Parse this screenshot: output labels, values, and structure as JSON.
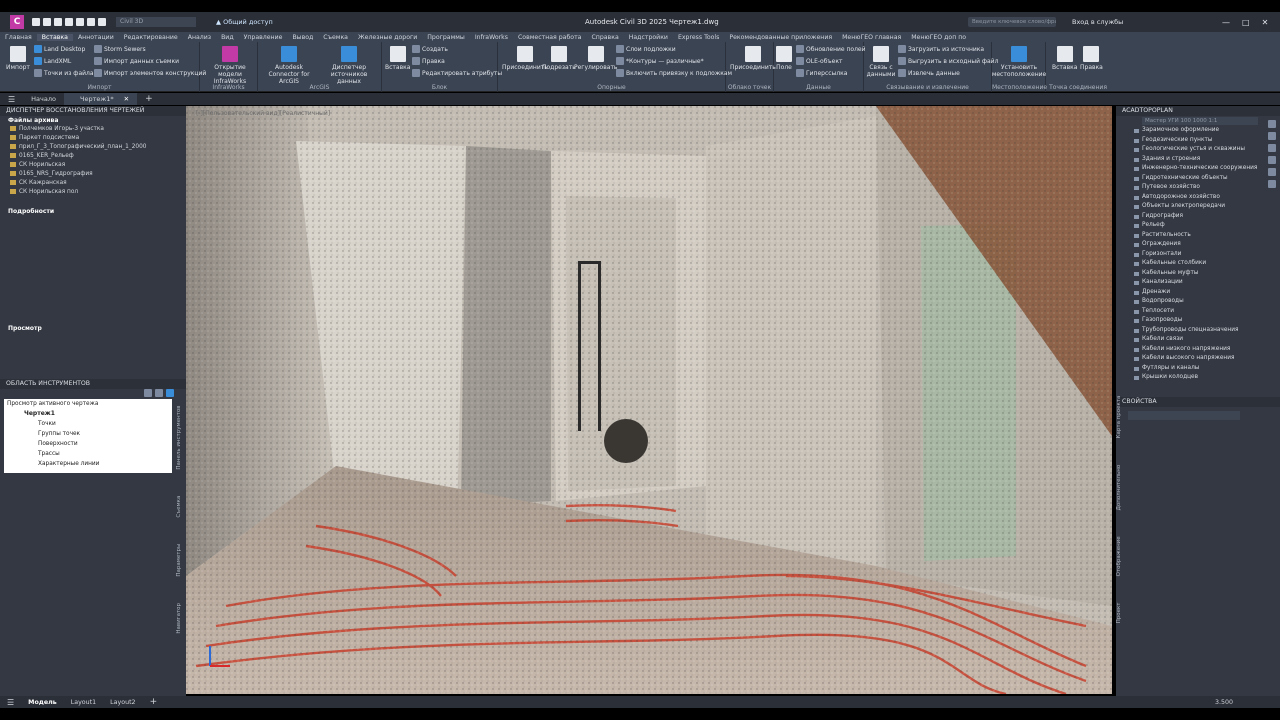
{
  "window": {
    "title": "Autodesk Civil 3D 2025   Чертеж1.dwg",
    "search_placeholder": "Введите ключевое слово/фразу",
    "signin": "Вход в службы",
    "share": "Общий доступ",
    "workspace": "Civil 3D"
  },
  "ribbon_tabs": [
    "Главная",
    "Вставка",
    "Аннотации",
    "Редактирование",
    "Анализ",
    "Вид",
    "Управление",
    "Вывод",
    "Съемка",
    "Железные дороги",
    "Программы",
    "InfraWorks",
    "Совместная работа",
    "Справка",
    "Надстройки",
    "Express Tools",
    "Рекомендованные приложения",
    "МенюГЕО главная",
    "МенюГЕО доп по"
  ],
  "ribbon_active": "Вставка",
  "ribbon": {
    "import": {
      "btn": "Импорт",
      "items": [
        "Land Desktop",
        "LandXML",
        "Точки из файла"
      ],
      "items2": [
        "Storm Sewers",
        "Импорт данных съемки",
        "Импорт элементов конструкций"
      ],
      "title": "Импорт"
    },
    "infraworks": {
      "btn": "Открытие модели InfraWorks",
      "title": "InfraWorks"
    },
    "arcgis": {
      "btn1": "Autodesk Connector for ArcGIS",
      "btn2": "Диспетчер источников данных",
      "title": "ArcGIS"
    },
    "block": {
      "btn": "Вставка",
      "items": [
        "Создать",
        "Правка",
        "Редактировать атрибуты"
      ],
      "title": "Блок"
    },
    "reference": {
      "btns": [
        "Присоединить",
        "Подрезать",
        "Регулировать"
      ],
      "items": [
        "Слои подложки",
        "*Контуры — различные*",
        "Включить привязку к подложкам"
      ],
      "title": "Опорные"
    },
    "pointcloud": {
      "btn": "Присоединить",
      "title": "Облако точек"
    },
    "data": {
      "btn": "Поле",
      "items": [
        "Обновление полей",
        "OLE-объект",
        "Гиперссылка"
      ],
      "title": "Данные"
    },
    "linking": {
      "btn": "Связь с данными",
      "items": [
        "Загрузить из источника",
        "Выгрузить в исходный файл",
        "Извлечь данные"
      ],
      "title": "Связывание и извлечение"
    },
    "location": {
      "btn": "Установить местоположение",
      "title": "Местоположение"
    },
    "contentpoints": {
      "btns": [
        "Вставка",
        "Правка"
      ],
      "title": "Точка соединения"
    }
  },
  "doc_tabs": [
    "Начало",
    "Чертеж1*"
  ],
  "left": {
    "recovery_title": "ДИСПЕТЧЕР ВОССТАНОВЛЕНИЯ ЧЕРТЕЖЕЙ",
    "archive_files": "Файлы архива",
    "files": [
      "Полчемков Игорь-3 участка",
      "Паркет подсистема",
      "прил_Г_3_Топографический_план_1_2000",
      "0165_KER_Рельеф",
      "СК Норильская",
      "0165_NRS_Гидрография",
      "СК Кажранская",
      "СК Норильская пол"
    ],
    "details": "Подробности",
    "preview": "Просмотр",
    "toolspace_title": "ОБЛАСТЬ ИНСТРУМЕНТОВ",
    "toolspace_view": "Просмотр активного чертежа",
    "drawing": "Чертеж1",
    "drawing_items": [
      "Точки",
      "Группы точек",
      "Поверхности",
      "Трассы",
      "Характерные линии"
    ],
    "side_tabs": [
      "Навигатор",
      "Параметры",
      "Съемка",
      "Панель инструментов"
    ]
  },
  "viewport": {
    "label": "[-][Пользовательский вид][Реалистичный]"
  },
  "right": {
    "title": "ACADTOPOPLAN",
    "selector": "Мастер УГИ 100 1000 1:1",
    "items": [
      "Зарамочное оформление",
      "Геодезические пункты",
      "Геологические устья и скважины",
      "Здания и строения",
      "Инженерно-технические сооружения",
      "Гидротехнические объекты",
      "Путевое хозяйство",
      "Автодорожное хозяйство",
      "Объекты электропередачи",
      "Гидрография",
      "Рельеф",
      "Растительность",
      "Ограждения",
      "Горизонтали",
      "Кабельные столбики",
      "Кабельные муфты",
      "Канализации",
      "Дренажи",
      "Водопроводы",
      "Теплосети",
      "Газопроводы",
      "Трубопроводы спецназначения",
      "Кабели связи",
      "Кабели низкого напряжения",
      "Кабели высокого напряжения",
      "Футляры и каналы",
      "Крышки колодцев"
    ],
    "properties": "СВОЙСТВА",
    "side_tabs": [
      "Проект",
      "Отображение",
      "Дополнительно",
      "Карта проекта"
    ]
  },
  "status": {
    "model": "Модель",
    "layouts": [
      "Layout1",
      "Layout2"
    ],
    "scale": "3.500"
  },
  "colors": {
    "accent": "#3b4453",
    "panel": "#333842",
    "pipe": "#c8412e"
  }
}
